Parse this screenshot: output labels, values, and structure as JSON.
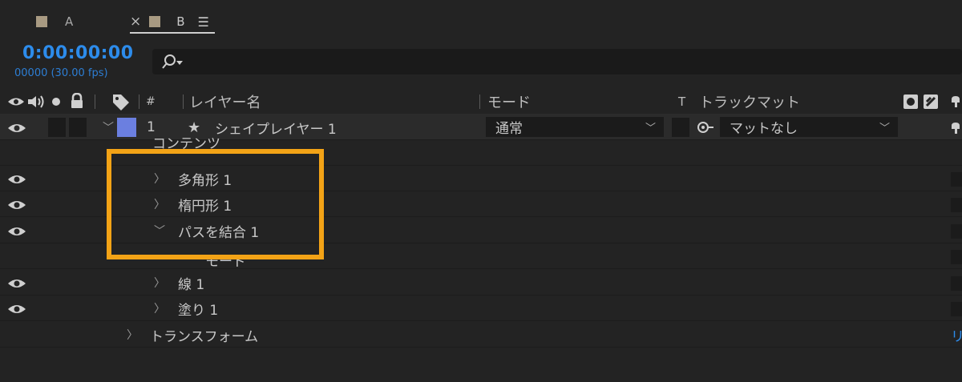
{
  "tabs": [
    {
      "label": "A",
      "swatch_color": "#a89a82"
    },
    {
      "label": "B",
      "swatch_color": "#a89a82",
      "close": "×",
      "menu": "☰"
    }
  ],
  "timecode": "0:00:00:00",
  "frames_info": "00000 (30.00 fps)",
  "search": {
    "placeholder": ""
  },
  "headers": {
    "number": "#",
    "layer_name": "レイヤー名",
    "mode": "モード",
    "t": "T",
    "track_matte": "トラックマット"
  },
  "layer": {
    "index": "1",
    "name": "シェイプレイヤー 1",
    "label_color": "#6b7fe0",
    "mode": "通常",
    "matte": "マットなし"
  },
  "rows": {
    "contents": "コンテンツ",
    "polygon": "多角形 1",
    "ellipse": "楕円形 1",
    "merge": "パスを結合 1",
    "mode_sub": "モード",
    "stroke": "線 1",
    "fill": "塗り 1",
    "transform": "トランスフォーム",
    "reset": "リ"
  },
  "highlight_color": "#f3a316",
  "accent_color": "#2d8ceb"
}
